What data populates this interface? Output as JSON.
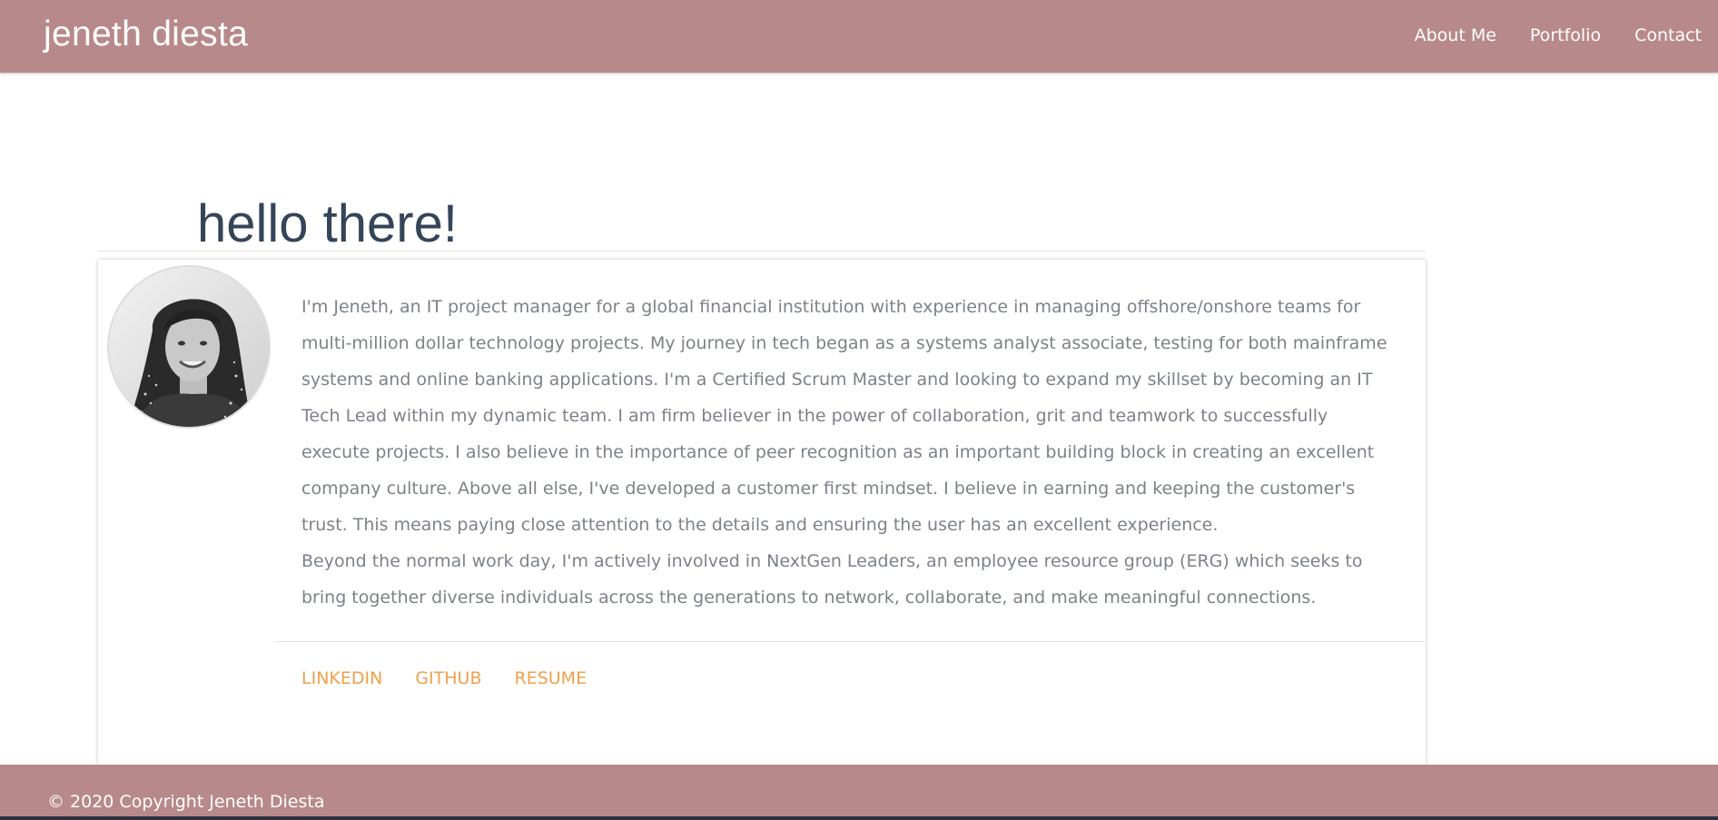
{
  "header": {
    "brand": "jeneth diesta",
    "nav": [
      {
        "label": "About Me"
      },
      {
        "label": "Portfolio"
      },
      {
        "label": "Contact"
      }
    ]
  },
  "main": {
    "title": "hello there!",
    "bio": {
      "paragraph1": "I'm Jeneth, an IT project manager for a global financial institution with experience in managing offshore/onshore teams for multi-million dollar technology projects. My journey in tech began as a systems analyst associate, testing for both mainframe systems and online banking applications. I'm a Certified Scrum Master and looking to expand my skillset by becoming an IT Tech Lead within my dynamic team. I am firm believer in the power of collaboration, grit and teamwork to successfully execute projects. I also believe in the importance of peer recognition as an important building block in creating an excellent company culture. Above all else, I've developed a customer first mindset. I believe in earning and keeping the customer's trust. This means paying close attention to the details and ensuring the user has an excellent experience.",
      "paragraph2": "Beyond the normal work day, I'm actively involved in NextGen Leaders, an employee resource group (ERG) which seeks to bring together diverse individuals across the generations to network, collaborate, and make meaningful connections."
    },
    "links": [
      {
        "label": "LINKEDIN"
      },
      {
        "label": "GITHUB"
      },
      {
        "label": "RESUME"
      }
    ]
  },
  "footer": {
    "copyright": "© 2020 Copyright Jeneth Diesta"
  },
  "colors": {
    "header_bg": "#b8898a",
    "title": "#344459",
    "body_text": "#7d8288",
    "link_accent": "#f0a04b"
  }
}
